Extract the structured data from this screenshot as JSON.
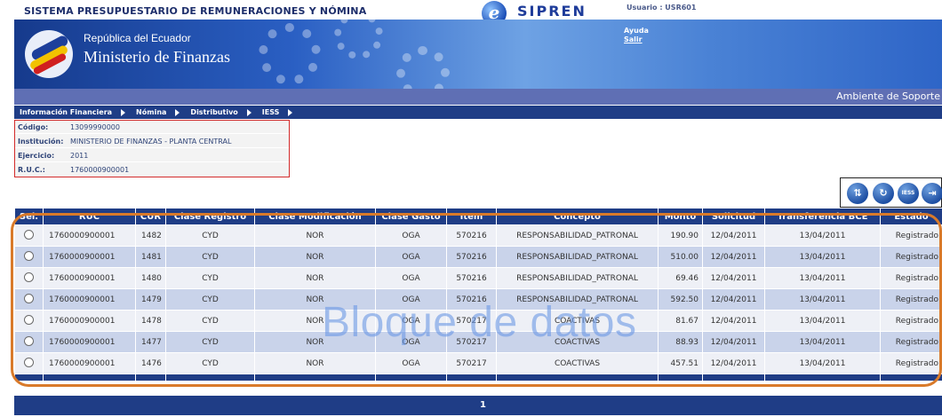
{
  "header": {
    "system_title": "SISTEMA PRESUPUESTARIO DE REMUNERACIONES Y NÓMINA",
    "logo_text": "SIPREN",
    "logo_letter": "e",
    "user_label": "Usuario : USR601",
    "republic": "República del Ecuador",
    "ministry": "Ministerio de Finanzas",
    "help_link": "Ayuda",
    "logout_link": "Salir"
  },
  "environment_label": "Ambiente de Soporte",
  "menu": [
    {
      "label": "Información Financiera"
    },
    {
      "label": "Nómina"
    },
    {
      "label": "Distributivo"
    },
    {
      "label": "IESS"
    }
  ],
  "info": {
    "codigo": {
      "label": "Código:",
      "value": "13099990000"
    },
    "institucion": {
      "label": "Institución:",
      "value": "MINISTERIO DE FINANZAS - PLANTA CENTRAL"
    },
    "ejercicio": {
      "label": "Ejercicio:",
      "value": "2011"
    },
    "ruc": {
      "label": "R.U.C.:",
      "value": "1760000900001"
    }
  },
  "action_icons": [
    {
      "name": "network-icon",
      "glyph": "⇅"
    },
    {
      "name": "refresh-icon",
      "glyph": "↻"
    },
    {
      "name": "iess-icon",
      "glyph": "IESS"
    },
    {
      "name": "exit-icon",
      "glyph": "⇥"
    }
  ],
  "table": {
    "columns": [
      "Sel.",
      "RUC",
      "CUR",
      "Clase Registro",
      "Clase Modificación",
      "Clase Gasto",
      "Item",
      "Concepto",
      "Monto",
      "Solicitud",
      "Transferencia BCE",
      "Estado"
    ],
    "rows": [
      [
        "1760000900001",
        "1482",
        "CYD",
        "NOR",
        "OGA",
        "570216",
        "RESPONSABILIDAD_PATRONAL",
        "190.90",
        "12/04/2011",
        "13/04/2011",
        "Registrado"
      ],
      [
        "1760000900001",
        "1481",
        "CYD",
        "NOR",
        "OGA",
        "570216",
        "RESPONSABILIDAD_PATRONAL",
        "510.00",
        "12/04/2011",
        "13/04/2011",
        "Registrado"
      ],
      [
        "1760000900001",
        "1480",
        "CYD",
        "NOR",
        "OGA",
        "570216",
        "RESPONSABILIDAD_PATRONAL",
        "69.46",
        "12/04/2011",
        "13/04/2011",
        "Registrado"
      ],
      [
        "1760000900001",
        "1479",
        "CYD",
        "NOR",
        "OGA",
        "570216",
        "RESPONSABILIDAD_PATRONAL",
        "592.50",
        "12/04/2011",
        "13/04/2011",
        "Registrado"
      ],
      [
        "1760000900001",
        "1478",
        "CYD",
        "NOR",
        "OGA",
        "570217",
        "COACTIVAS",
        "81.67",
        "12/04/2011",
        "13/04/2011",
        "Registrado"
      ],
      [
        "1760000900001",
        "1477",
        "CYD",
        "NOR",
        "OGA",
        "570217",
        "COACTIVAS",
        "88.93",
        "12/04/2011",
        "13/04/2011",
        "Registrado"
      ],
      [
        "1760000900001",
        "1476",
        "CYD",
        "NOR",
        "OGA",
        "570217",
        "COACTIVAS",
        "457.51",
        "12/04/2011",
        "13/04/2011",
        "Registrado"
      ]
    ]
  },
  "overlay_caption": "Bloque de datos",
  "pager": {
    "current_page": "1"
  },
  "colors": {
    "header_blue": "#1f3d86",
    "env_bar": "#5f6fb4",
    "row_odd": "#eef0f6",
    "row_even": "#c9d3ea",
    "highlight_orange": "#d97a2a",
    "info_border_red": "#d32b2b"
  }
}
